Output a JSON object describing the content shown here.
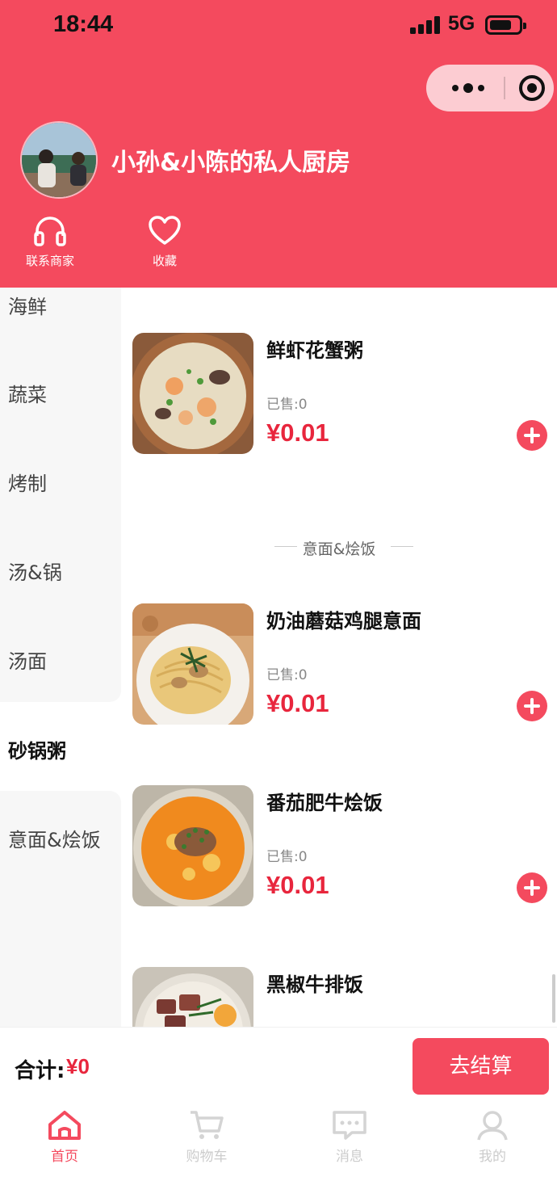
{
  "status_bar": {
    "time": "18:44",
    "network": "5G"
  },
  "colors": {
    "primary": "#f44a5e",
    "price": "#e8263d"
  },
  "header": {
    "shop_name": "小孙&小陈的私人厨房",
    "actions": [
      {
        "label": "联系商家",
        "icon": "headset-icon"
      },
      {
        "label": "收藏",
        "icon": "heart-icon"
      }
    ]
  },
  "categories": [
    {
      "label": "海鲜",
      "active": false
    },
    {
      "label": "蔬菜",
      "active": false
    },
    {
      "label": "烤制",
      "active": false
    },
    {
      "label": "汤&锅",
      "active": false
    },
    {
      "label": "汤面",
      "active": false
    },
    {
      "label": "砂锅粥",
      "active": true
    },
    {
      "label": "意面&烩饭",
      "active": false
    }
  ],
  "dishes": [
    {
      "name": "鲜虾花蟹粥",
      "sold": "已售:0",
      "price": "¥0.01"
    },
    {
      "name": "奶油蘑菇鸡腿意面",
      "sold": "已售:0",
      "price": "¥0.01"
    },
    {
      "name": "番茄肥牛烩饭",
      "sold": "已售:0",
      "price": "¥0.01"
    },
    {
      "name": "黑椒牛排饭"
    }
  ],
  "section_title": "意面&烩饭",
  "checkout": {
    "total_label": "合计:",
    "total_value": "¥0",
    "button_label": "去结算"
  },
  "tabs": [
    {
      "label": "首页",
      "icon": "home-icon",
      "active": true
    },
    {
      "label": "购物车",
      "icon": "cart-icon",
      "active": false
    },
    {
      "label": "消息",
      "icon": "message-icon",
      "active": false
    },
    {
      "label": "我的",
      "icon": "user-icon",
      "active": false
    }
  ]
}
